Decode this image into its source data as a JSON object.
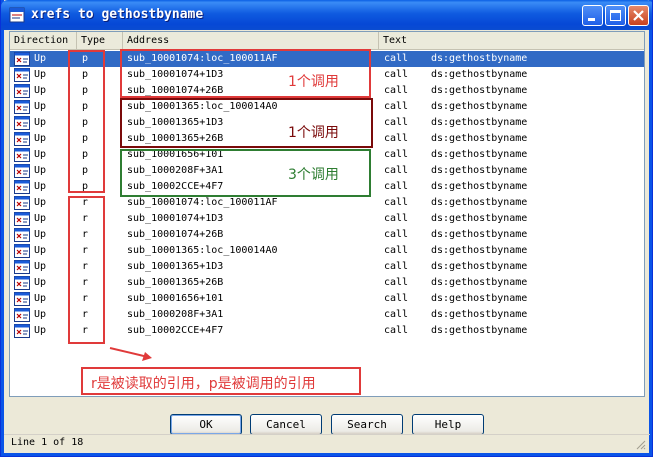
{
  "window": {
    "title": "xrefs to gethostbyname"
  },
  "columns": [
    "Direction",
    "Type",
    "Address",
    "Text"
  ],
  "rows": [
    {
      "direction": "Up",
      "type": "p",
      "address": "sub_10001074:loc_100011AF",
      "op": "call",
      "operand": "ds:gethostbyname",
      "selected": true
    },
    {
      "direction": "Up",
      "type": "p",
      "address": "sub_10001074+1D3",
      "op": "call",
      "operand": "ds:gethostbyname"
    },
    {
      "direction": "Up",
      "type": "p",
      "address": "sub_10001074+26B",
      "op": "call",
      "operand": "ds:gethostbyname"
    },
    {
      "direction": "Up",
      "type": "p",
      "address": "sub_10001365:loc_100014A0",
      "op": "call",
      "operand": "ds:gethostbyname"
    },
    {
      "direction": "Up",
      "type": "p",
      "address": "sub_10001365+1D3",
      "op": "call",
      "operand": "ds:gethostbyname"
    },
    {
      "direction": "Up",
      "type": "p",
      "address": "sub_10001365+26B",
      "op": "call",
      "operand": "ds:gethostbyname"
    },
    {
      "direction": "Up",
      "type": "p",
      "address": "sub_10001656+101",
      "op": "call",
      "operand": "ds:gethostbyname"
    },
    {
      "direction": "Up",
      "type": "p",
      "address": "sub_1000208F+3A1",
      "op": "call",
      "operand": "ds:gethostbyname"
    },
    {
      "direction": "Up",
      "type": "p",
      "address": "sub_10002CCE+4F7",
      "op": "call",
      "operand": "ds:gethostbyname"
    },
    {
      "direction": "Up",
      "type": "r",
      "address": "sub_10001074:loc_100011AF",
      "op": "call",
      "operand": "ds:gethostbyname"
    },
    {
      "direction": "Up",
      "type": "r",
      "address": "sub_10001074+1D3",
      "op": "call",
      "operand": "ds:gethostbyname"
    },
    {
      "direction": "Up",
      "type": "r",
      "address": "sub_10001074+26B",
      "op": "call",
      "operand": "ds:gethostbyname"
    },
    {
      "direction": "Up",
      "type": "r",
      "address": "sub_10001365:loc_100014A0",
      "op": "call",
      "operand": "ds:gethostbyname"
    },
    {
      "direction": "Up",
      "type": "r",
      "address": "sub_10001365+1D3",
      "op": "call",
      "operand": "ds:gethostbyname"
    },
    {
      "direction": "Up",
      "type": "r",
      "address": "sub_10001365+26B",
      "op": "call",
      "operand": "ds:gethostbyname"
    },
    {
      "direction": "Up",
      "type": "r",
      "address": "sub_10001656+101",
      "op": "call",
      "operand": "ds:gethostbyname"
    },
    {
      "direction": "Up",
      "type": "r",
      "address": "sub_1000208F+3A1",
      "op": "call",
      "operand": "ds:gethostbyname"
    },
    {
      "direction": "Up",
      "type": "r",
      "address": "sub_10002CCE+4F7",
      "op": "call",
      "operand": "ds:gethostbyname"
    }
  ],
  "annotations": {
    "group1": "1个调用",
    "group2": "1个调用",
    "group3": "3个调用",
    "note": "r是被读取的引用，p是被调用的引用",
    "colors": {
      "red": "#e03a3a",
      "dark_red": "#7a0a0a",
      "green": "#2e7d32"
    }
  },
  "buttons": {
    "ok": "OK",
    "cancel": "Cancel",
    "search": "Search",
    "help": "Help"
  },
  "status": "Line 1 of 18",
  "colors": {
    "selection": "#316ac5",
    "titlebar": "#0a5fe4"
  }
}
